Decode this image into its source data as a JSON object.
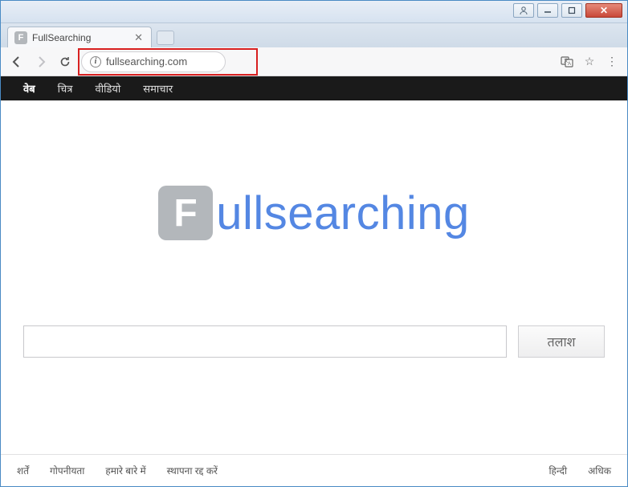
{
  "window_controls": {
    "user": "",
    "minimize": "",
    "maximize": "",
    "close": "✕"
  },
  "tab": {
    "favicon_letter": "F",
    "title": "FullSearching"
  },
  "toolbar": {
    "url": "fullsearching.com"
  },
  "catnav": [
    "वेब",
    "चित्र",
    "वीडियो",
    "समाचार"
  ],
  "logo": {
    "icon_letter": "F",
    "text": "ullsearching"
  },
  "search": {
    "value": "",
    "button": "तलाश"
  },
  "footer": {
    "left": [
      "शर्तें",
      "गोपनीयता",
      "हमारे बारे में",
      "स्थापना रद्द करें"
    ],
    "right": [
      "हिन्दी",
      "अधिक"
    ]
  }
}
